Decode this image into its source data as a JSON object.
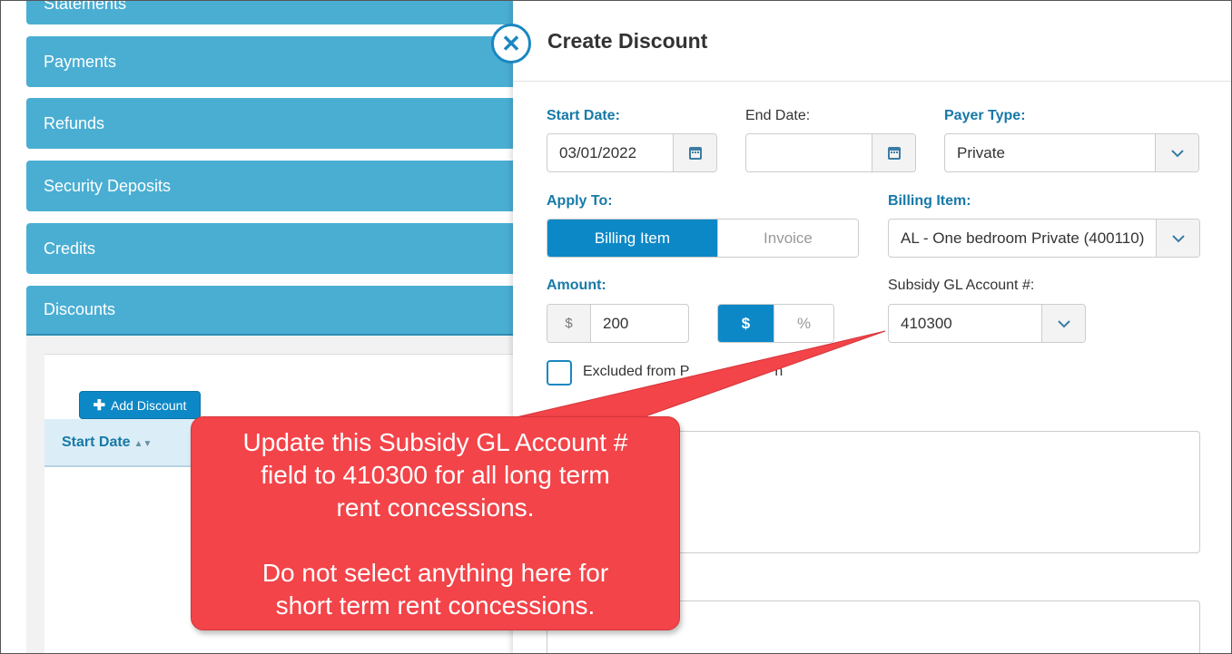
{
  "sidebar": {
    "items": [
      {
        "label": "Statements"
      },
      {
        "label": "Payments"
      },
      {
        "label": "Refunds"
      },
      {
        "label": "Security Deposits"
      },
      {
        "label": "Credits"
      },
      {
        "label": "Discounts"
      }
    ],
    "add_discount_label": "Add Discount",
    "table_header_start_date": "Start Date"
  },
  "dialog": {
    "title": "Create Discount",
    "start_date_label": "Start Date:",
    "start_date_value": "03/01/2022",
    "end_date_label": "End Date:",
    "end_date_value": "",
    "payer_type_label": "Payer Type:",
    "payer_type_value": "Private",
    "apply_to_label": "Apply To:",
    "apply_to_options": [
      "Billing Item",
      "Invoice"
    ],
    "billing_item_label": "Billing Item:",
    "billing_item_value": "AL - One bedroom Private (400110)",
    "amount_label": "Amount:",
    "amount_prefix": "$",
    "amount_value": "200",
    "amount_type_options": [
      "$",
      "%"
    ],
    "subsidy_label": "Subsidy GL Account #:",
    "subsidy_value": "410300",
    "excluded_label": "Excluded from P",
    "excluded_label_tail": "n"
  },
  "callout": {
    "line1": "Update this Subsidy GL Account #",
    "line2": "field to 410300 for all long term",
    "line3": "rent concessions.",
    "line4": "Do not select anything here for",
    "line5": "short term rent concessions."
  },
  "colors": {
    "accordion": "#4aaed3",
    "primary": "#0d88c7",
    "label_blue": "#1779a8",
    "callout": "#f24449"
  }
}
